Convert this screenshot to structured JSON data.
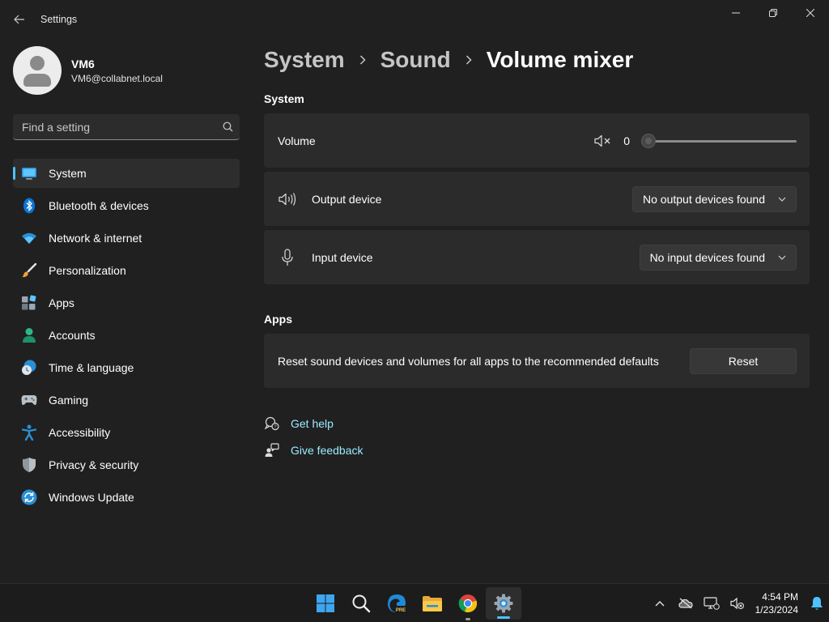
{
  "window": {
    "title": "Settings"
  },
  "profile": {
    "name": "VM6",
    "email": "VM6@collabnet.local"
  },
  "search": {
    "placeholder": "Find a setting"
  },
  "nav": {
    "items": [
      {
        "label": "System",
        "icon": "system-icon",
        "active": true
      },
      {
        "label": "Bluetooth & devices",
        "icon": "bluetooth-icon"
      },
      {
        "label": "Network & internet",
        "icon": "wifi-icon"
      },
      {
        "label": "Personalization",
        "icon": "brush-icon"
      },
      {
        "label": "Apps",
        "icon": "apps-icon"
      },
      {
        "label": "Accounts",
        "icon": "accounts-icon"
      },
      {
        "label": "Time & language",
        "icon": "clock-globe-icon"
      },
      {
        "label": "Gaming",
        "icon": "gamepad-icon"
      },
      {
        "label": "Accessibility",
        "icon": "accessibility-icon"
      },
      {
        "label": "Privacy & security",
        "icon": "shield-icon"
      },
      {
        "label": "Windows Update",
        "icon": "update-icon"
      }
    ]
  },
  "breadcrumb": {
    "items": [
      "System",
      "Sound",
      "Volume mixer"
    ]
  },
  "system_section": {
    "title": "System",
    "volume": {
      "label": "Volume",
      "value": "0",
      "level": 0
    },
    "output": {
      "label": "Output device",
      "value": "No output devices found"
    },
    "input": {
      "label": "Input device",
      "value": "No input devices found"
    }
  },
  "apps_section": {
    "title": "Apps",
    "reset_text": "Reset sound devices and volumes for all apps to the recommended defaults",
    "reset_button": "Reset"
  },
  "links": {
    "help": "Get help",
    "feedback": "Give feedback"
  },
  "taskbar": {
    "time": "4:54 PM",
    "date": "1/23/2024"
  },
  "colors": {
    "accent": "#4cc2ff",
    "link": "#99ebff",
    "background": "#202020",
    "card": "#2b2b2b"
  }
}
